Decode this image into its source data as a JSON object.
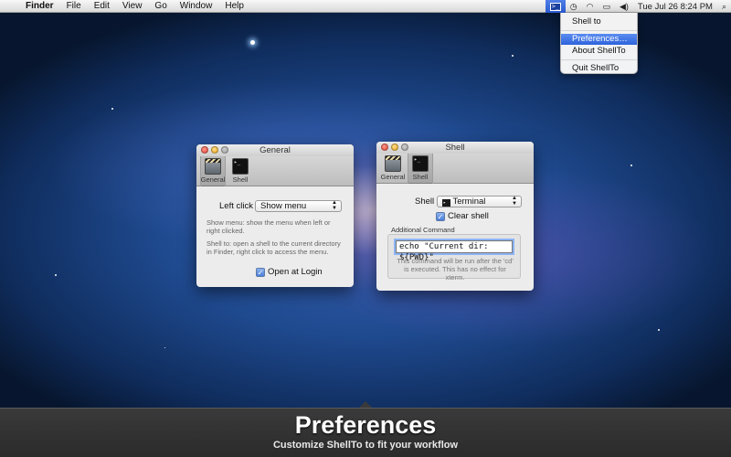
{
  "menubar": {
    "apple_glyph": "",
    "app_name": "Finder",
    "menus": [
      "File",
      "Edit",
      "View",
      "Go",
      "Window",
      "Help"
    ],
    "status": {
      "shellto_glyph": ">_",
      "clock_glyph": "◷",
      "wifi_glyph": "◠",
      "battery_glyph": "▭",
      "volume_glyph": "◀)",
      "datetime": "Tue Jul 26  8:24 PM",
      "search_glyph": "⌕"
    }
  },
  "dropdown": {
    "items": [
      "Shell to",
      "Preferences…",
      "About ShellTo",
      "Quit ShellTo"
    ],
    "selected": "Preferences…"
  },
  "general_window": {
    "title": "General",
    "tabs": [
      "General",
      "Shell"
    ],
    "left_click_label": "Left click",
    "left_click_value": "Show menu",
    "help_show_menu": "Show menu: show the menu when left or right clicked.",
    "help_shell_to": "Shell to: open a shell to the current directory in Finder, right click to access the menu.",
    "open_at_login_label": "Open at Login",
    "open_at_login_checked": true
  },
  "shell_window": {
    "title": "Shell",
    "tabs": [
      "General",
      "Shell"
    ],
    "shell_label": "Shell",
    "shell_value": "Terminal",
    "clear_shell_label": "Clear shell",
    "clear_shell_checked": true,
    "additional_command_label": "Additional Command",
    "command_value": "echo \"Current dir: ${PWD}\"",
    "command_help": "This command will be run after the 'cd' is executed. This has no effect for xterm."
  },
  "banner": {
    "title": "Preferences",
    "subtitle": "Customize ShellTo to fit your workflow"
  },
  "colors": {
    "accent": "#2e63dc",
    "banner_bg": "#2f2f2f"
  }
}
